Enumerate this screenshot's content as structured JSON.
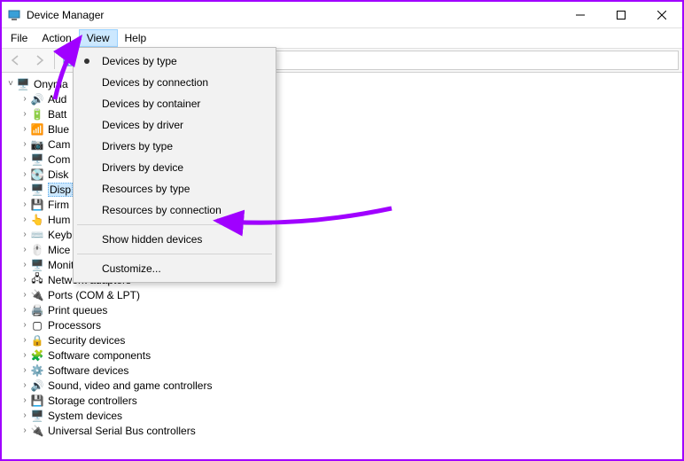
{
  "window": {
    "title": "Device Manager"
  },
  "menubar": {
    "items": [
      "File",
      "Action",
      "View",
      "Help"
    ]
  },
  "popup": {
    "items_a": [
      "Devices by type",
      "Devices by connection",
      "Devices by container",
      "Devices by driver",
      "Drivers by type",
      "Drivers by device",
      "Resources by type",
      "Resources by connection"
    ],
    "show_hidden": "Show hidden devices",
    "customize": "Customize..."
  },
  "tree": {
    "root": "Onyma",
    "children": [
      {
        "label": "Aud",
        "trunc": true
      },
      {
        "label": "Batt",
        "trunc": true
      },
      {
        "label": "Blue",
        "trunc": true
      },
      {
        "label": "Cam",
        "trunc": true
      },
      {
        "label": "Com",
        "trunc": true
      },
      {
        "label": "Disk",
        "trunc": true
      },
      {
        "label": "Disp",
        "trunc": true,
        "selected": true
      },
      {
        "label": "Firm",
        "trunc": true
      },
      {
        "label": "Hum",
        "trunc": true
      },
      {
        "label": "Keyb",
        "trunc": true
      },
      {
        "label": "Mice",
        "trunc": true
      },
      {
        "label": "Monitors"
      },
      {
        "label": "Network adapters"
      },
      {
        "label": "Ports (COM & LPT)"
      },
      {
        "label": "Print queues"
      },
      {
        "label": "Processors"
      },
      {
        "label": "Security devices"
      },
      {
        "label": "Software components"
      },
      {
        "label": "Software devices"
      },
      {
        "label": "Sound, video and game controllers"
      },
      {
        "label": "Storage controllers"
      },
      {
        "label": "System devices"
      },
      {
        "label": "Universal Serial Bus controllers"
      }
    ]
  },
  "icons": {
    "root": "🖥️",
    "items": [
      "🔊",
      "🔋",
      "📶",
      "📷",
      "🖥️",
      "💽",
      "🖥️",
      "💾",
      "👆",
      "⌨️",
      "🖱️",
      "🖥️",
      "🖧",
      "🔌",
      "🖨️",
      "▢",
      "🔒",
      "🧩",
      "⚙️",
      "🔊",
      "💾",
      "🖥️",
      "🔌"
    ]
  }
}
